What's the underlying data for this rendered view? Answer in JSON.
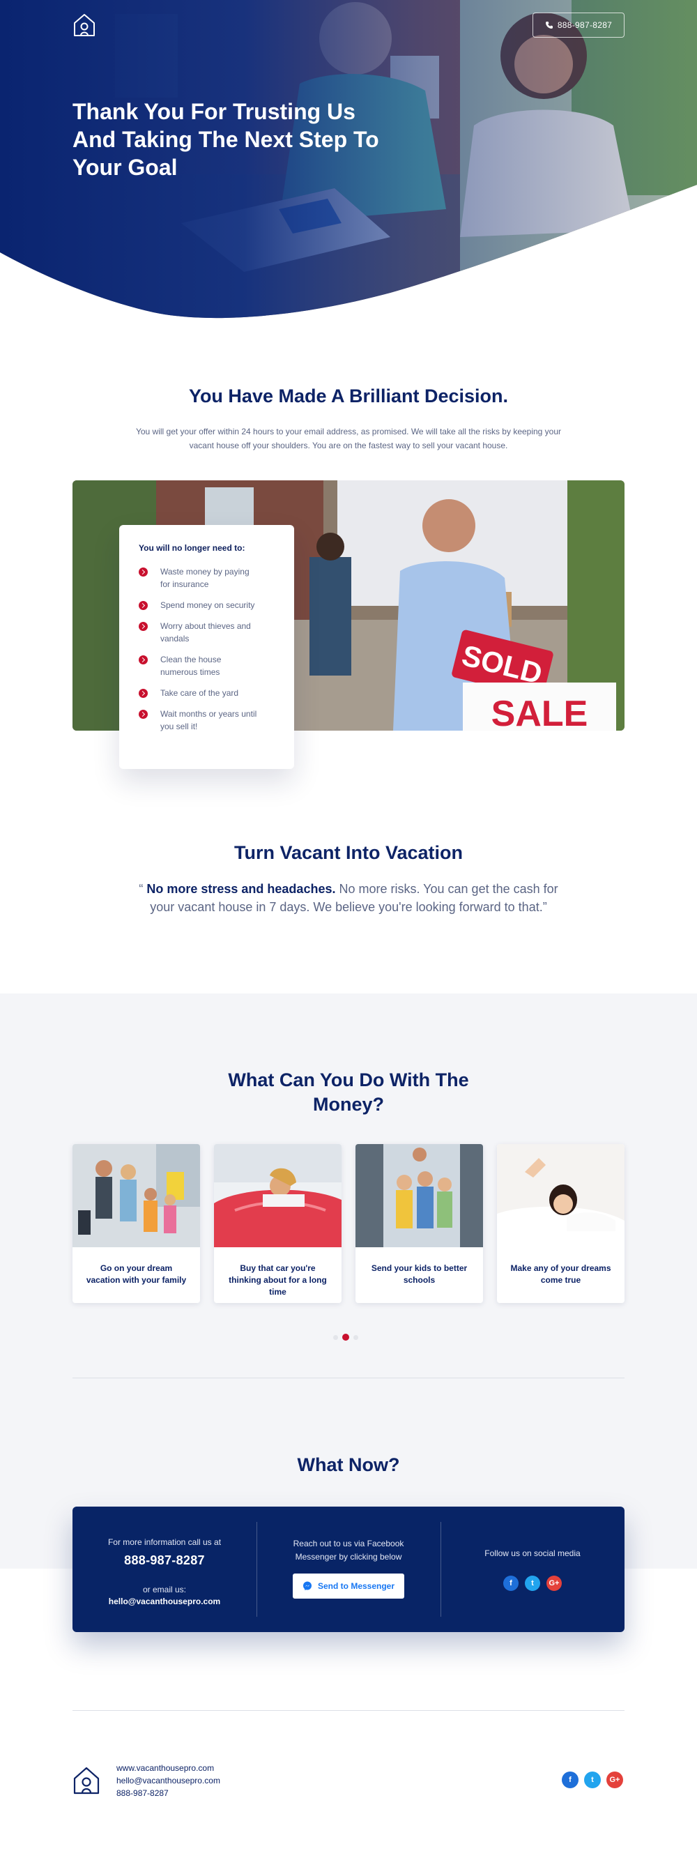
{
  "header": {
    "phone": "888-987-8287"
  },
  "hero": {
    "title": "Thank You For Trusting Us And Taking The Next Step To Your Goal"
  },
  "decision": {
    "title": "You Have Made A Brilliant Decision.",
    "text": "You will get your offer within 24 hours to your email address, as promised. We will take all the risks by keeping your vacant house off your shoulders. You are on the fastest way to sell your vacant house."
  },
  "no_longer": {
    "title": "You will no longer need to:",
    "items": [
      "Waste money by paying for insurance",
      "Spend money on security",
      "Worry about thieves and vandals",
      "Clean the house numerous times",
      "Take care of the yard",
      "Wait months or years until you sell it!"
    ]
  },
  "sign": {
    "sold": "SOLD",
    "sale": "SALE"
  },
  "vacation": {
    "title": "Turn Vacant Into Vacation",
    "quote_open": "“",
    "quote_bold": "No more stress and headaches.",
    "quote_rest": " No more risks. You can get the cash for your vacant house in 7 days. We believe you're looking forward to that.”"
  },
  "money": {
    "title": "What Can You Do With The Money?",
    "cards": [
      {
        "label": "Go on your dream vacation with your family",
        "icon": "family-vacation-photo"
      },
      {
        "label": "Buy that car you're thinking about for a long time",
        "icon": "red-car-photo"
      },
      {
        "label": "Send your kids to better schools",
        "icon": "school-kids-photo"
      },
      {
        "label": "Make any of your dreams come true",
        "icon": "dreaming-woman-photo"
      }
    ],
    "active_slide": 2,
    "total_slides": 3
  },
  "what_now": {
    "title": "What Now?",
    "call_label": "For more information call us at",
    "phone": "888-987-8287",
    "email_label": "or email us:",
    "email": "hello@vacanthousepro.com",
    "messenger_text": "Reach out to us via Facebook Messenger by clicking below",
    "messenger_button": "Send to Messenger",
    "social_label": "Follow us on social media"
  },
  "footer": {
    "website": "www.vacanthousepro.com",
    "email": "hello@vacanthousepro.com",
    "phone": "888-987-8287"
  },
  "colors": {
    "navy": "#0d2366",
    "accent_red": "#c8102e",
    "facebook": "#1e6fd9",
    "twitter": "#22a4ee",
    "google_plus": "#e4413b"
  }
}
